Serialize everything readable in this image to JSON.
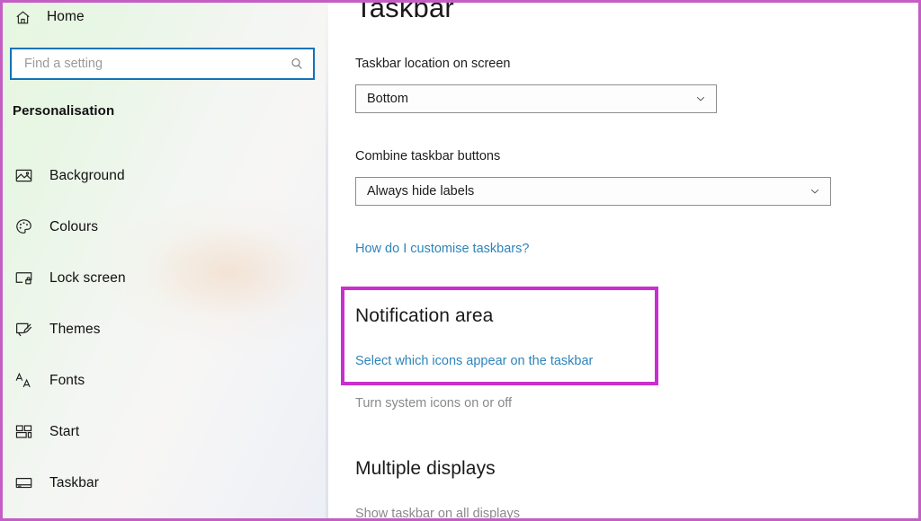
{
  "window": {
    "frame_color": "#c45ec4"
  },
  "sidebar": {
    "home": {
      "label": "Home",
      "icon": "home-icon"
    },
    "search": {
      "value": "",
      "placeholder": "Find a setting",
      "icon": "search-icon"
    },
    "section_title": "Personalisation",
    "items": [
      {
        "label": "Background",
        "icon": "image-icon"
      },
      {
        "label": "Colours",
        "icon": "palette-icon"
      },
      {
        "label": "Lock screen",
        "icon": "lock-screen-icon"
      },
      {
        "label": "Themes",
        "icon": "brush-icon"
      },
      {
        "label": "Fonts",
        "icon": "fonts-icon"
      },
      {
        "label": "Start",
        "icon": "start-tiles-icon"
      },
      {
        "label": "Taskbar",
        "icon": "taskbar-icon"
      }
    ]
  },
  "main": {
    "page_title": "Taskbar",
    "taskbar_location": {
      "label": "Taskbar location on screen",
      "value": "Bottom",
      "chevron": "chevron-down-icon"
    },
    "combine_buttons": {
      "label": "Combine taskbar buttons",
      "value": "Always hide labels",
      "chevron": "chevron-down-icon"
    },
    "customise_link": "How do I customise taskbars?",
    "notification_area": {
      "heading": "Notification area",
      "link": "Select which icons appear on the taskbar",
      "secondary_link": "Turn system icons on or off",
      "highlight_color": "#c92fcd"
    },
    "multiple_displays": {
      "heading": "Multiple displays",
      "first_option": "Show taskbar on all displays"
    }
  }
}
